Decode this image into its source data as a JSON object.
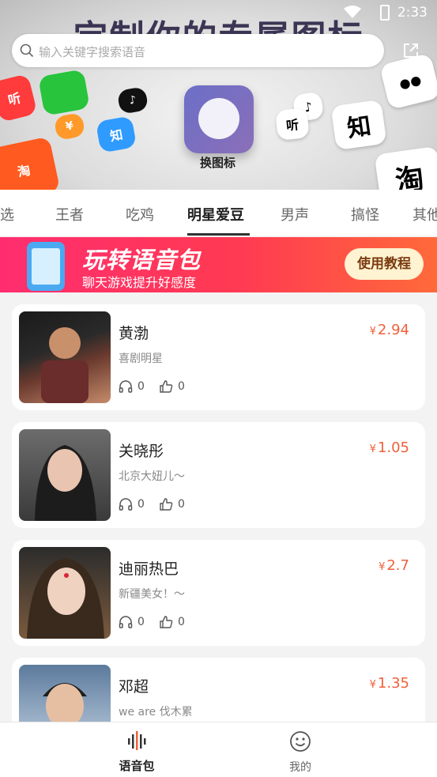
{
  "status": {
    "time": "2:33"
  },
  "hero": {
    "title": "定制你的专属图标",
    "center_label": "换图标"
  },
  "search": {
    "placeholder": "输入关键字搜索语音"
  },
  "tabs": [
    {
      "label": "选"
    },
    {
      "label": "王者"
    },
    {
      "label": "吃鸡"
    },
    {
      "label": "明星爱豆"
    },
    {
      "label": "男声"
    },
    {
      "label": "搞怪"
    },
    {
      "label": "其他"
    }
  ],
  "promo": {
    "title": "玩转语音包",
    "subtitle": "聊天游戏提升好感度",
    "button": "使用教程"
  },
  "cards": [
    {
      "name": "黄渤",
      "desc": "喜剧明星",
      "price": "2.94",
      "currency": "¥",
      "listens": "0",
      "likes": "0"
    },
    {
      "name": "关晓彤",
      "desc": "北京大妞儿～",
      "price": "1.05",
      "currency": "¥",
      "listens": "0",
      "likes": "0"
    },
    {
      "name": "迪丽热巴",
      "desc": "新疆美女！～",
      "price": "2.7",
      "currency": "¥",
      "listens": "0",
      "likes": "0"
    },
    {
      "name": "邓超",
      "desc": "we are 伐木累",
      "price": "1.35",
      "currency": "¥"
    }
  ],
  "bottom_nav": [
    {
      "label": "语音包",
      "icon": "sound-wave-icon"
    },
    {
      "label": "我的",
      "icon": "smiley-icon"
    }
  ],
  "colors": {
    "accent": "#f0603a",
    "promo_start": "#ff2d6f",
    "promo_end": "#ff6a3a"
  }
}
